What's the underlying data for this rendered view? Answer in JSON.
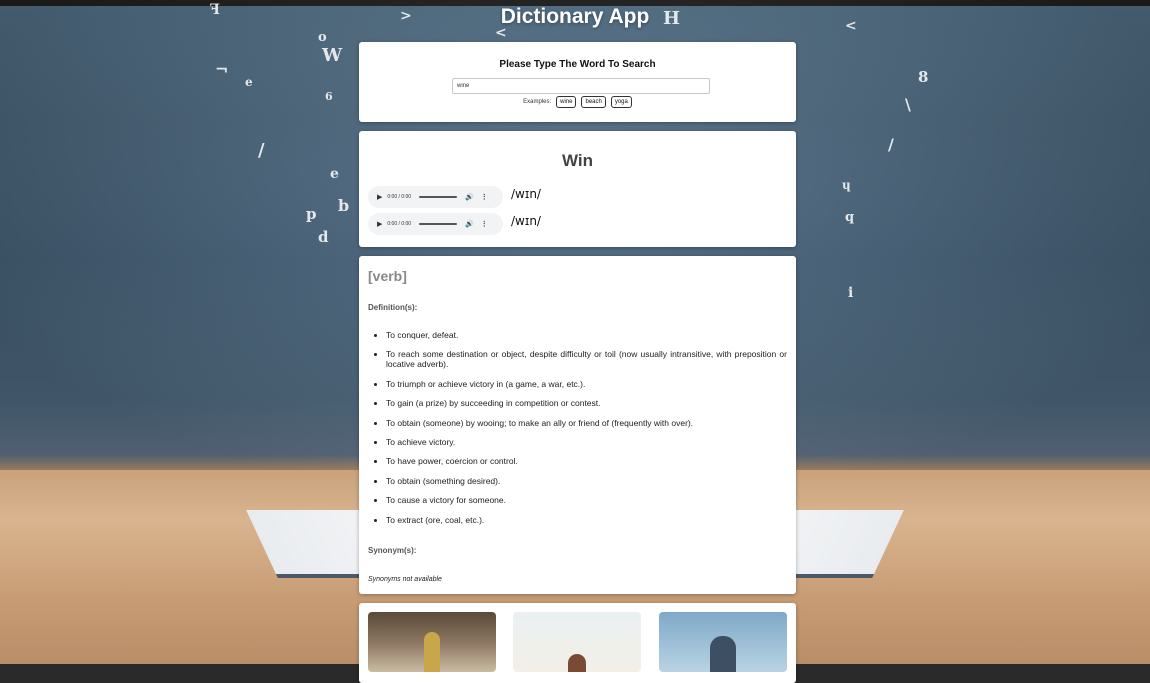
{
  "app": {
    "title": "Dictionary App"
  },
  "search": {
    "heading": "Please Type The Word To Search",
    "value": "wine",
    "examples_label": "Examples:",
    "examples": [
      "wine",
      "beach",
      "yoga"
    ]
  },
  "word": {
    "title": "Win",
    "pronunciations": [
      {
        "time": "0:00 / 0:00",
        "phonetic": "/wɪn/"
      },
      {
        "time": "0:00 / 0:00",
        "phonetic": "/wɪn/"
      }
    ]
  },
  "meaning": {
    "part_of_speech": "[verb]",
    "definitions_label": "Definition(s):",
    "definitions": [
      "To conquer, defeat.",
      "To reach some destination or object, despite difficulty or toil (now usually intransitive, with preposition or locative adverb).",
      "To triumph or achieve victory in (a game, a war, etc.).",
      "To gain (a prize) by succeeding in competition or contest.",
      "To obtain (someone) by wooing; to make an ally or friend of (frequently with over).",
      "To achieve victory.",
      "To have power, coercion or control.",
      "To obtain (something desired).",
      "To cause a victory for someone.",
      "To extract (ore, coal, etc.)."
    ],
    "synonyms_label": "Synonym(s):",
    "synonyms_empty": "Synonyms not available"
  },
  "icons": {
    "play": "play-icon",
    "volume": "volume-icon",
    "more": "more-options-icon"
  },
  "colors": {
    "card": "#ffffff",
    "part_of_speech": "#888888",
    "title_text": "#ffffff"
  }
}
